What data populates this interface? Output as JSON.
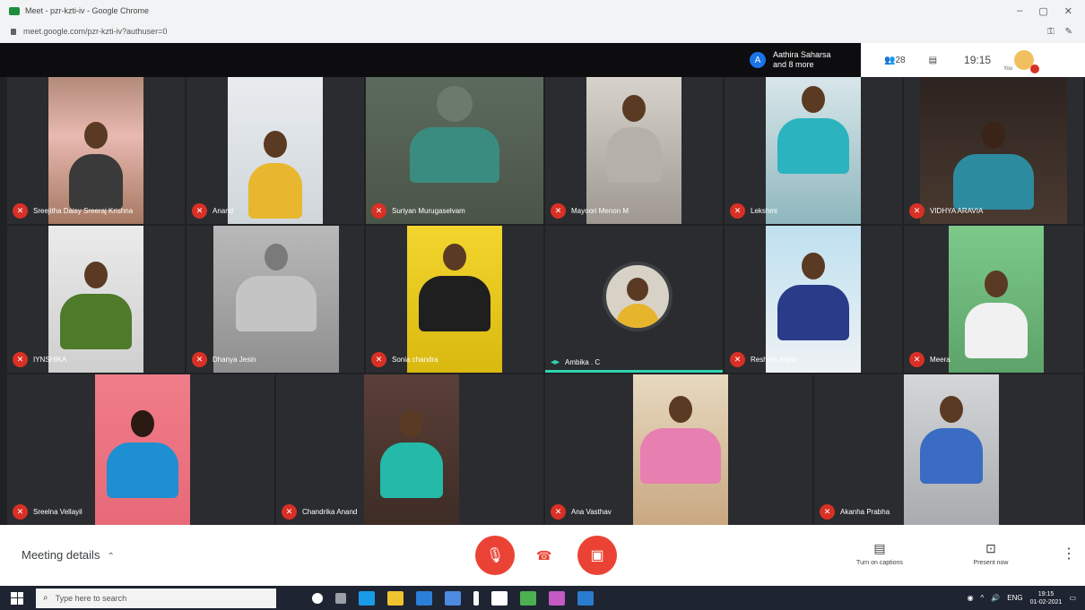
{
  "browser": {
    "tab_title": "Meet - pzr-kzti-iv - Google Chrome",
    "url": "meet.google.com/pzr-kzti-iv?authuser=0",
    "window_controls": [
      "–",
      "▢",
      "✕"
    ]
  },
  "top_bar": {
    "participants_chip_avatar": "A",
    "participants_chip_text": "Aathira Saharsa and 8 more",
    "people_count": "28",
    "clock": "19:15",
    "self_label": "You"
  },
  "tiles": [
    {
      "name": "Sreejitha Daisy Sreeraj Krishna",
      "muted": true
    },
    {
      "name": "Anand",
      "muted": true
    },
    {
      "name": "Suriyan Murugaselvam",
      "muted": true
    },
    {
      "name": "Mayoori Menon M",
      "muted": true
    },
    {
      "name": "Lekshmi",
      "muted": true
    },
    {
      "name": "VIDHYA ARAVIA",
      "muted": true
    },
    {
      "name": "IYNSHIKA",
      "muted": true
    },
    {
      "name": "Dhanya Jesin",
      "muted": true
    },
    {
      "name": "Sonia chandra",
      "muted": true
    },
    {
      "name": "Ambika . C",
      "muted": false,
      "speaking": true
    },
    {
      "name": "Reshma Anjali",
      "muted": true
    },
    {
      "name": "Meera",
      "muted": true
    },
    {
      "name": "Sreelna Vellayil",
      "muted": true
    },
    {
      "name": "Chandrika Anand",
      "muted": true
    },
    {
      "name": "Ana Vasthav",
      "muted": true
    },
    {
      "name": "Akanha Prabha",
      "muted": true
    }
  ],
  "bottom_bar": {
    "meeting_details": "Meeting details",
    "turn_on_captions": "Turn on captions",
    "present_now": "Present now"
  },
  "taskbar": {
    "search_placeholder": "Type here to search",
    "time": "19:15",
    "date": "01-02-2021",
    "lang": "ENG"
  },
  "colors": {
    "mute_red": "#d93025",
    "control_red": "#ea4335",
    "speaking_teal": "#2fd3b0",
    "grid_bg": "#202124",
    "tile_bg": "#2b2c2f"
  },
  "icons": [
    "mic-off-icon",
    "camera-off-icon",
    "hangup-icon",
    "captions-icon",
    "present-icon",
    "more-vert-icon",
    "chevron-up-icon",
    "people-icon",
    "chat-icon",
    "windows-start-icon",
    "search-icon"
  ]
}
